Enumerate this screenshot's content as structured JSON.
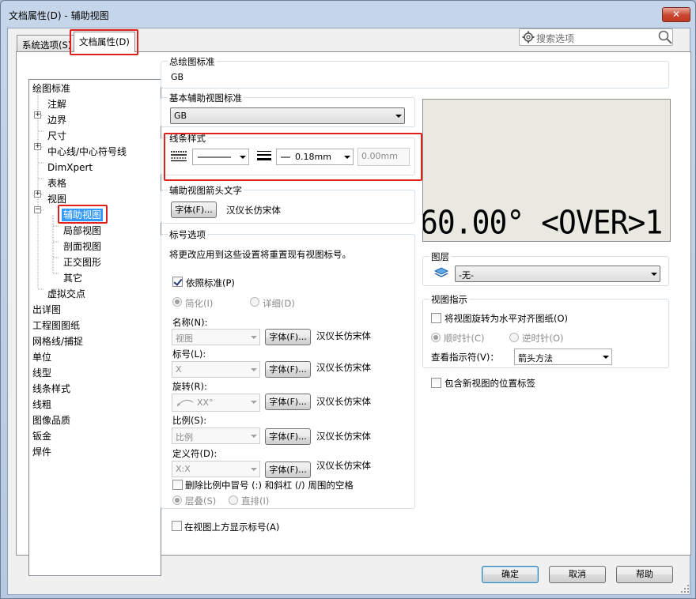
{
  "window": {
    "title": "文档属性(D) - 辅助视图",
    "close_glyph": "✕"
  },
  "tabs": [
    {
      "label": "系统选项(S)"
    },
    {
      "label": "文档属性(D)"
    }
  ],
  "search": {
    "placeholder": "搜索选项"
  },
  "tree": [
    {
      "label": "绘图标准"
    },
    {
      "label": "注解",
      "expander": "+"
    },
    {
      "label": "边界"
    },
    {
      "label": "尺寸",
      "expander": "+"
    },
    {
      "label": "中心线/中心符号线"
    },
    {
      "label": "DimXpert"
    },
    {
      "label": "表格",
      "expander": "+"
    },
    {
      "label": "视图",
      "expander": "−"
    },
    {
      "label": "辅助视图",
      "selected": true
    },
    {
      "label": "局部视图"
    },
    {
      "label": "剖面视图"
    },
    {
      "label": "正交图形"
    },
    {
      "label": "其它"
    },
    {
      "label": "虚拟交点"
    },
    {
      "label": "出详图"
    },
    {
      "label": "工程图图纸"
    },
    {
      "label": "网格线/捕捉"
    },
    {
      "label": "单位"
    },
    {
      "label": "线型"
    },
    {
      "label": "线条样式"
    },
    {
      "label": "线粗"
    },
    {
      "label": "图像品质"
    },
    {
      "label": "钣金"
    },
    {
      "label": "焊件"
    }
  ],
  "overall_standard": {
    "label": "总绘图标准",
    "value": "GB"
  },
  "base_standard": {
    "label": "基本辅助视图标准",
    "value": "GB"
  },
  "line_style": {
    "label": "线条样式",
    "thickness": "0.18mm",
    "custom_thickness": "0.00mm"
  },
  "arrow_text": {
    "label": "辅助视图箭头文字",
    "font_button": "字体(F)...",
    "font_name": "汉仪长仿宋体"
  },
  "label_options": {
    "label": "标号选项",
    "apply_text": "将更改应用到这些设置将重置现有视图标号。",
    "per_standard": "依照标准(P)",
    "per_standard_checked": true,
    "simple": "简化(I)",
    "detailed": "详细(D)",
    "rows": [
      {
        "label": "名称(N):",
        "value": "视图",
        "font_button": "字体(F)...",
        "font_name": "汉仪长仿宋体"
      },
      {
        "label": "标号(L):",
        "value": "X",
        "font_button": "字体(F)...",
        "font_name": "汉仪长仿宋体"
      },
      {
        "label": "旋转(R):",
        "value": "XX°",
        "font_button": "字体(F)...",
        "font_name": "汉仪长仿宋体"
      },
      {
        "label": "比例(S):",
        "value": "比例",
        "font_button": "字体(F)...",
        "font_name": "汉仪长仿宋体"
      },
      {
        "label": "定义符(D):",
        "value": "X:X",
        "font_button": "字体(F)...",
        "font_name": "汉仪长仿宋体"
      }
    ],
    "delete_spaces": "删除比例中冒号 (:) 和斜杠 (/) 周围的空格",
    "stacked": "层叠(S)",
    "inline": "直排(I)"
  },
  "show_label_above": "在视图上方显示标号(A)",
  "preview": {
    "text": "60.00° <OVER>1"
  },
  "layer": {
    "label": "图层",
    "value": "-无-"
  },
  "view_indicator": {
    "label": "视图指示",
    "rotate": "将视图旋转为水平对齐图纸(O)",
    "cw": "顺时针(C)",
    "ccw": "逆时针(O)",
    "indicator_label": "查看指示符(V)：",
    "indicator_value": "箭头方法"
  },
  "include_label": "包含新视图的位置标签",
  "buttons": {
    "ok": "确定",
    "cancel": "取消",
    "help": "帮助"
  }
}
